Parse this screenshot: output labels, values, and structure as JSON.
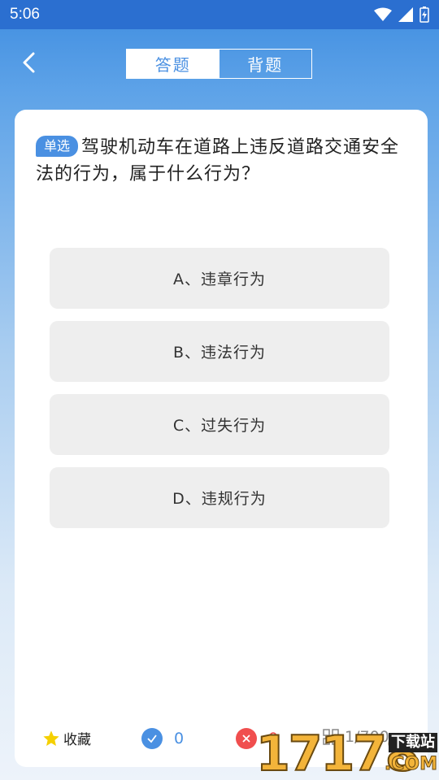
{
  "status_bar": {
    "time": "5:06"
  },
  "tabs": [
    {
      "label": "答题",
      "active": true
    },
    {
      "label": "背题",
      "active": false
    }
  ],
  "question": {
    "type_badge": "单选",
    "text": "驾驶机动车在道路上违反道路交通安全法的行为，属于什么行为？"
  },
  "options": [
    {
      "label": "A、违章行为"
    },
    {
      "label": "B、违法行为"
    },
    {
      "label": "C、过失行为"
    },
    {
      "label": "D、违规行为"
    }
  ],
  "footer": {
    "favorite_label": "收藏",
    "correct_count": "0",
    "wrong_count": "0",
    "progress": "1/700"
  },
  "watermark": {
    "number": "17178",
    "site": "下载站",
    "domain": ".COM"
  },
  "colors": {
    "accent": "#4a90e2",
    "correct": "#4a90e2",
    "wrong": "#f04e4e",
    "star": "#f5d000"
  }
}
